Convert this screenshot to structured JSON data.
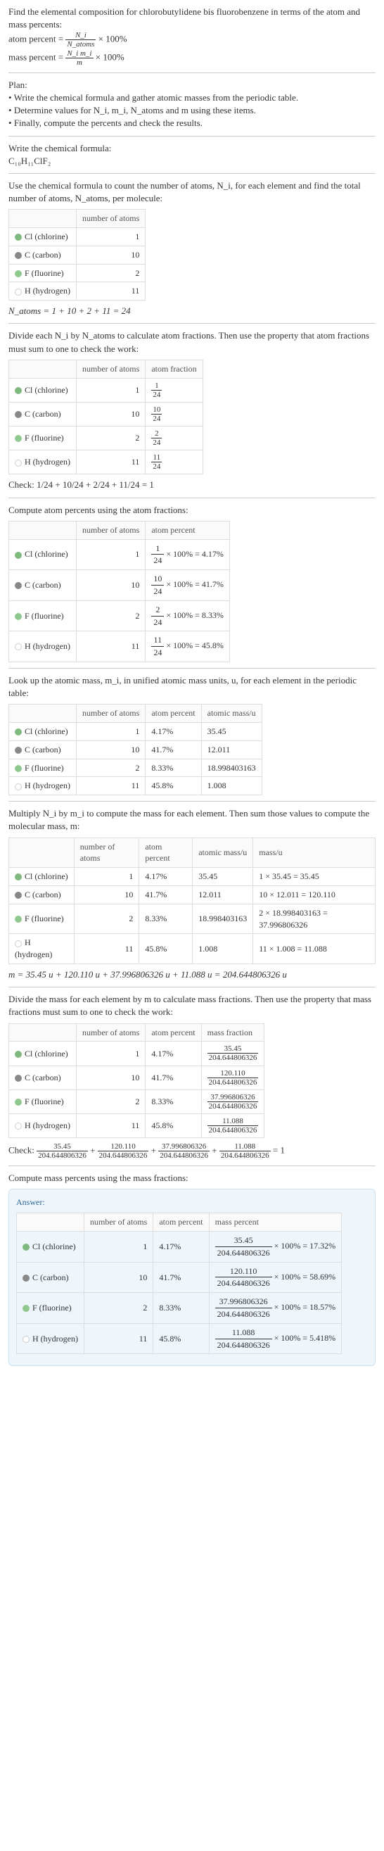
{
  "intro": {
    "line1": "Find the elemental composition for chlorobutylidene bis fluorobenzene in terms of the atom and mass percents:",
    "atom_label": "atom percent =",
    "atom_frac_num": "N_i",
    "atom_frac_den": "N_atoms",
    "times100": "× 100%",
    "mass_label": "mass percent =",
    "mass_frac_num": "N_i m_i",
    "mass_frac_den": "m"
  },
  "plan": {
    "title": "Plan:",
    "items": [
      "Write the chemical formula and gather atomic masses from the periodic table.",
      "Determine values for N_i, m_i, N_atoms and m using these items.",
      "Finally, compute the percents and check the results."
    ]
  },
  "formula": {
    "text": "Write the chemical formula:",
    "value": "C₁₀H₁₁ClF₂"
  },
  "count_intro": "Use the chemical formula to count the number of atoms, N_i, for each element and find the total number of atoms, N_atoms, per molecule:",
  "elements": [
    {
      "sym": "Cl",
      "name": "chlorine",
      "color": "#7fb97f",
      "n": 1,
      "frac": "1/24",
      "pct": "4.17%",
      "fracfull_num": "1",
      "fracfull_den": "24",
      "mass": "35.45",
      "massline": "1 × 35.45 = 35.45",
      "massfrac_num": "35.45",
      "ans_pct": "17.32%"
    },
    {
      "sym": "C",
      "name": "carbon",
      "color": "#888",
      "n": 10,
      "frac": "10/24",
      "pct": "41.7%",
      "fracfull_num": "10",
      "fracfull_den": "24",
      "mass": "12.011",
      "massline": "10 × 12.011 = 120.110",
      "massfrac_num": "120.110",
      "ans_pct": "58.69%"
    },
    {
      "sym": "F",
      "name": "fluorine",
      "color": "#8fc98f",
      "n": 2,
      "frac": "2/24",
      "pct": "8.33%",
      "fracfull_num": "2",
      "fracfull_den": "24",
      "mass": "18.998403163",
      "massline": "2 × 18.998403163 = 37.996806326",
      "massfrac_num": "37.996806326",
      "ans_pct": "18.57%"
    },
    {
      "sym": "H",
      "name": "hydrogen",
      "color": "#fff",
      "n": 11,
      "frac": "11/24",
      "pct": "45.8%",
      "fracfull_num": "11",
      "fracfull_den": "24",
      "mass": "1.008",
      "massline": "11 × 1.008 = 11.088",
      "massfrac_num": "11.088",
      "ans_pct": "5.418%"
    }
  ],
  "n_atoms_line": "N_atoms = 1 + 10 + 2 + 11 = 24",
  "atom_frac_intro": "Divide each N_i by N_atoms to calculate atom fractions. Then use the property that atom fractions must sum to one to check the work:",
  "check1": "Check: 1/24 + 10/24 + 2/24 + 11/24 = 1",
  "atom_pct_intro": "Compute atom percents using the atom fractions:",
  "mass_lookup_intro": "Look up the atomic mass, m_i, in unified atomic mass units, u, for each element in the periodic table:",
  "mass_compute_intro": "Multiply N_i by m_i to compute the mass for each element. Then sum those values to compute the molecular mass, m:",
  "m_total": "m = 35.45 u + 120.110 u + 37.996806326 u + 11.088 u = 204.644806326 u",
  "mass_frac_intro": "Divide the mass for each element by m to calculate mass fractions. Then use the property that mass fractions must sum to one to check the work:",
  "m_denom": "204.644806326",
  "check2_leader": "Check:",
  "check2_eq": "= 1",
  "mass_pct_intro": "Compute mass percents using the mass fractions:",
  "answer_label": "Answer:",
  "headers": {
    "noa": "number of atoms",
    "af": "atom fraction",
    "ap": "atom percent",
    "am": "atomic mass/u",
    "mu": "mass/u",
    "mf": "mass fraction",
    "mp": "mass percent"
  }
}
